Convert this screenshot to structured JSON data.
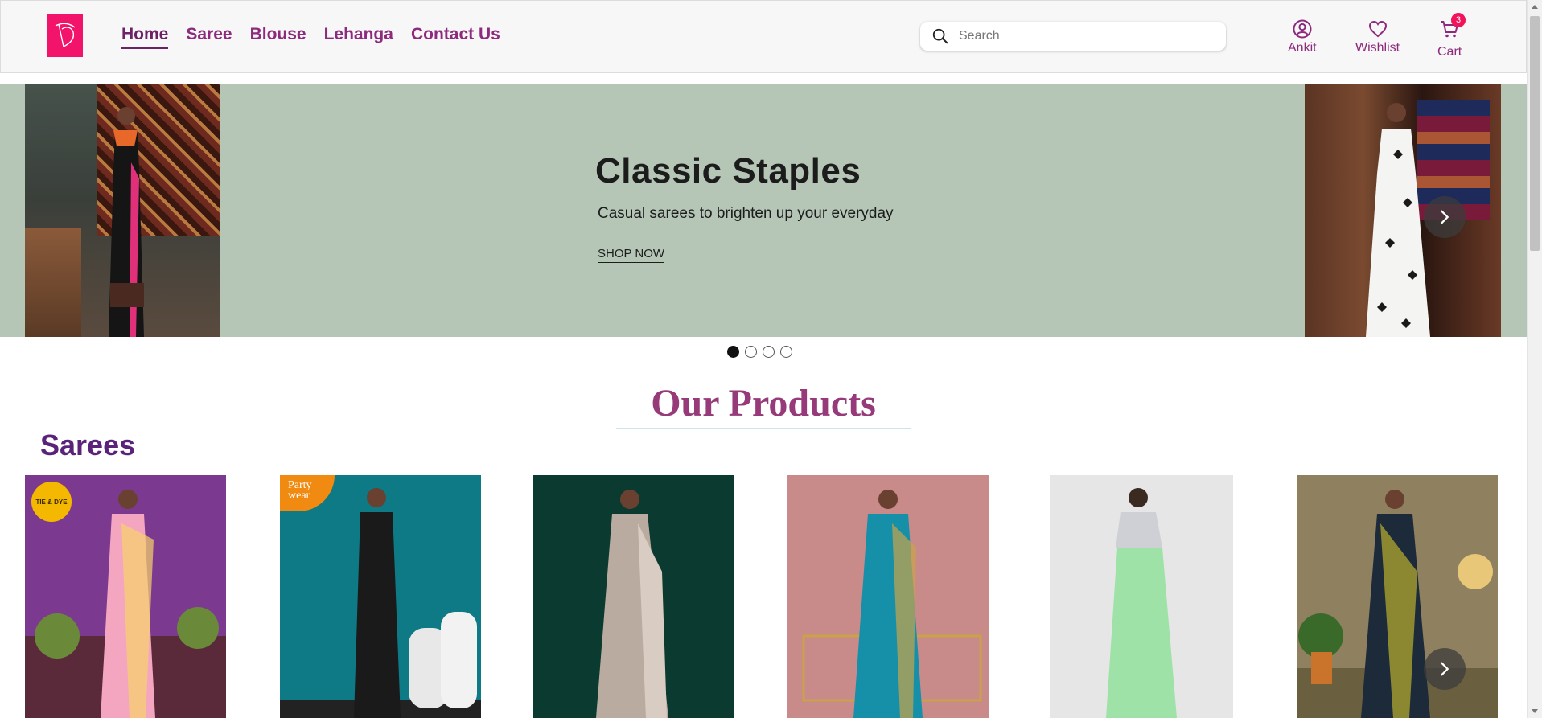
{
  "brand": {
    "logo_text": "VD",
    "color": "#f2136a"
  },
  "nav": {
    "items": [
      {
        "label": "Home",
        "active": true
      },
      {
        "label": "Saree",
        "active": false
      },
      {
        "label": "Blouse",
        "active": false
      },
      {
        "label": "Lehanga",
        "active": false
      },
      {
        "label": "Contact Us",
        "active": false
      }
    ]
  },
  "search": {
    "placeholder": "Search",
    "value": ""
  },
  "actions": {
    "account": {
      "label": "Ankit",
      "icon": "user-circle-icon"
    },
    "wishlist": {
      "label": "Wishlist",
      "icon": "heart-icon"
    },
    "cart": {
      "label": "Cart",
      "icon": "cart-icon",
      "count": "3"
    }
  },
  "banner": {
    "title": "Classic Staples",
    "subtitle": "Casual sarees to brighten up your everyday",
    "cta": "SHOP NOW",
    "slides": 4,
    "active_slide": 1
  },
  "products": {
    "heading": "Our Products",
    "section_title": "Sarees",
    "cards": [
      {
        "tag": "TIE & DYE",
        "colors": [
          "#7b3a8f",
          "#f4a6c0",
          "#d63a7a"
        ]
      },
      {
        "tag": "Party wear",
        "colors": [
          "#0d7a86",
          "#1a1a1a",
          "#e8e8e8"
        ]
      },
      {
        "tag": "",
        "colors": [
          "#0b3a30",
          "#b9aba0",
          "#d9cdc3"
        ]
      },
      {
        "tag": "",
        "colors": [
          "#c98a8a",
          "#1590a8",
          "#c9a24a"
        ]
      },
      {
        "tag": "",
        "colors": [
          "#e6e6e6",
          "#9fe2a8",
          "#cfcfd6"
        ]
      },
      {
        "tag": "",
        "colors": [
          "#8f8060",
          "#1c2a3a",
          "#a8a030"
        ]
      }
    ]
  },
  "colors": {
    "accent": "#8d2a7d",
    "heading": "#963a79",
    "section": "#5a2379",
    "banner_bg": "#b5c6b6"
  }
}
